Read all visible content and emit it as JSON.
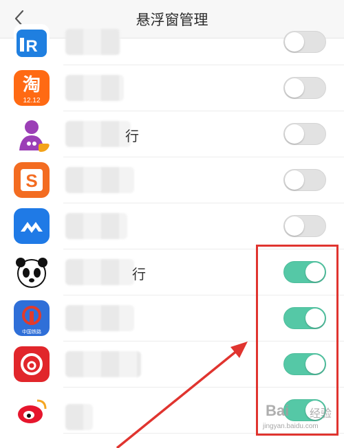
{
  "header": {
    "title": "悬浮窗管理",
    "back_icon": "chevron-left-icon"
  },
  "apps": [
    {
      "icon": "hr-app-icon",
      "label": "",
      "enabled": false
    },
    {
      "icon": "taobao-icon",
      "label": "",
      "enabled": false
    },
    {
      "icon": "purple-app-icon",
      "label": "行",
      "enabled": false
    },
    {
      "icon": "sogou-input-icon",
      "label": "",
      "enabled": false
    },
    {
      "icon": "blue-app-icon",
      "label": "",
      "enabled": false
    },
    {
      "icon": "panda-icon",
      "label": "行",
      "enabled": true
    },
    {
      "icon": "railway-icon",
      "label": "",
      "enabled": true
    },
    {
      "icon": "netease-music-icon",
      "label": "",
      "enabled": true
    },
    {
      "icon": "weibo-icon",
      "label": "",
      "enabled": true
    }
  ],
  "icon_texts": {
    "taobao": "淘",
    "taobao_date": "12.12",
    "railway": "中国铁路"
  },
  "colors": {
    "toggle_on": "#55c8a6",
    "toggle_off": "#e2e2e2",
    "highlight": "#e0342f"
  },
  "watermark": {
    "brand": "Bai",
    "suffix": "经验",
    "url": "jingyan.baidu.com"
  }
}
